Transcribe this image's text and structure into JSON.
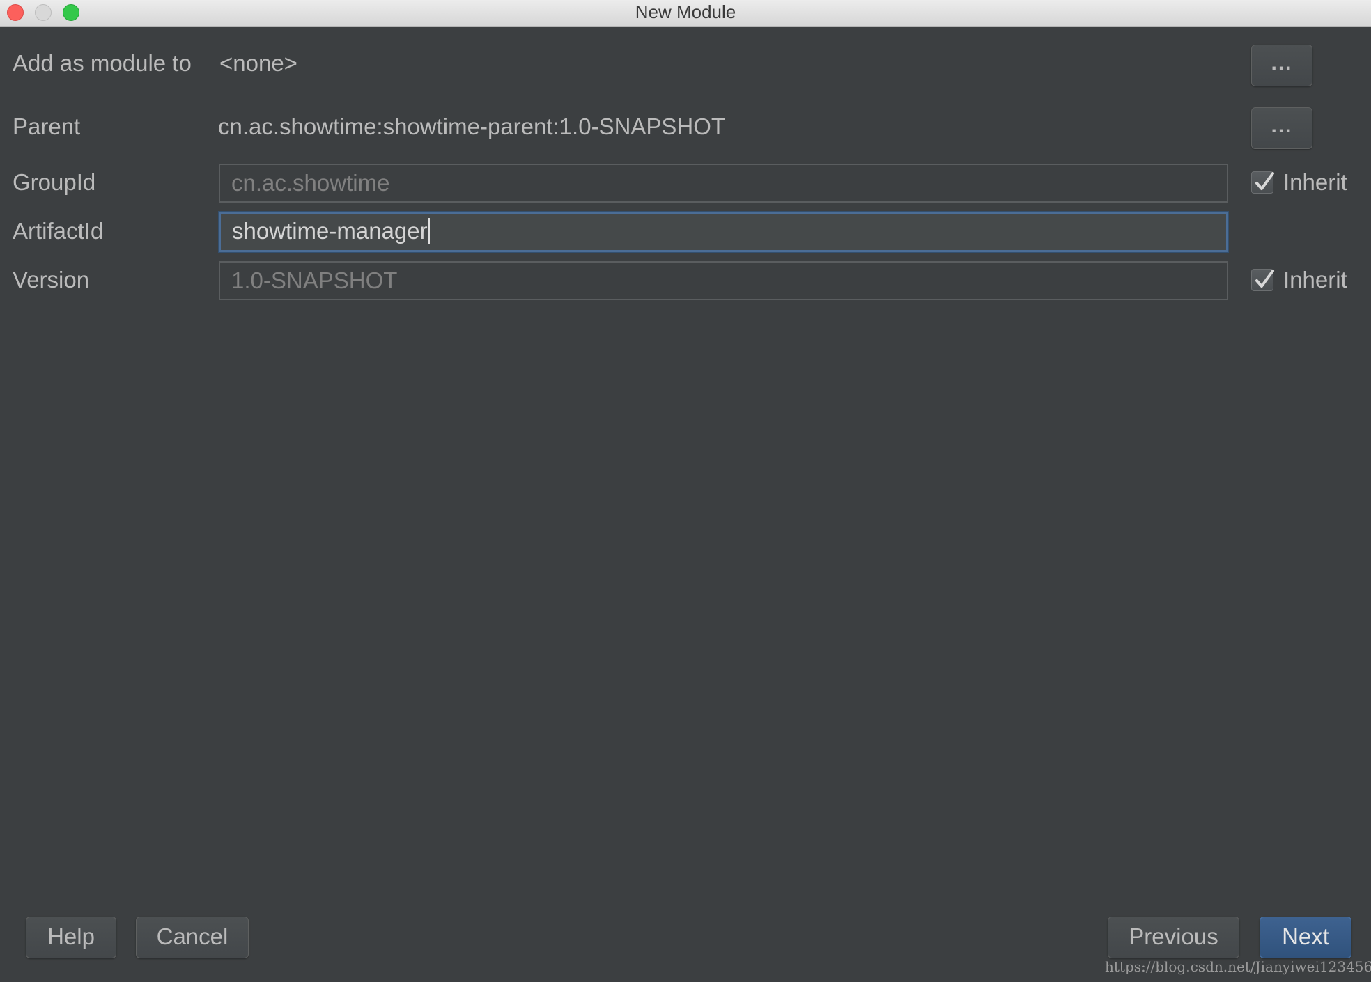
{
  "window": {
    "title": "New Module"
  },
  "form": {
    "add_as_module_to": {
      "label": "Add as module to",
      "value": "<none>",
      "button_label": "..."
    },
    "parent": {
      "label": "Parent",
      "value": "cn.ac.showtime:showtime-parent:1.0-SNAPSHOT",
      "button_label": "..."
    },
    "group_id": {
      "label": "GroupId",
      "value": "cn.ac.showtime",
      "inherit_label": "Inherit",
      "inherit_checked": true
    },
    "artifact_id": {
      "label": "ArtifactId",
      "value": "showtime-manager"
    },
    "version": {
      "label": "Version",
      "value": "1.0-SNAPSHOT",
      "inherit_label": "Inherit",
      "inherit_checked": true
    }
  },
  "footer": {
    "help_label": "Help",
    "cancel_label": "Cancel",
    "previous_label": "Previous",
    "next_label": "Next"
  },
  "watermark": "https://blog.csdn.net/Jianyiwei123456",
  "colors": {
    "background": "#3c3f41",
    "text": "#bbbbbb",
    "focus_border": "#4b6d96",
    "primary_button": "#365880"
  }
}
